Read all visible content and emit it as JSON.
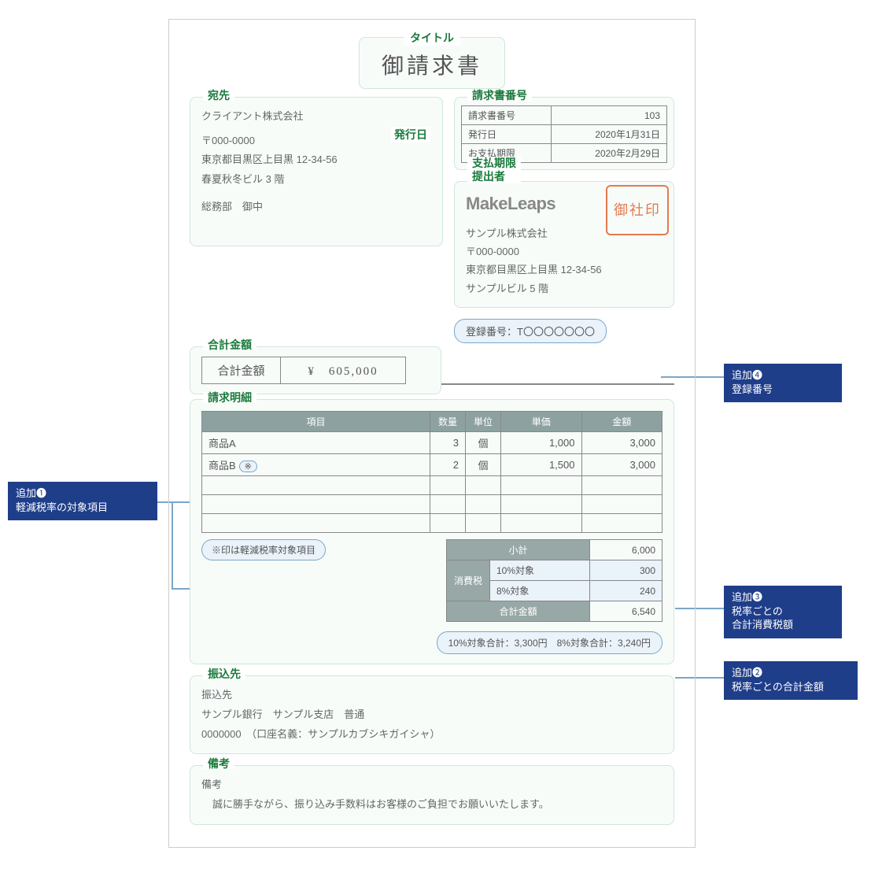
{
  "title": {
    "label": "タイトル",
    "text": "御請求書"
  },
  "recipient": {
    "label": "宛先",
    "company": "クライアント株式会社",
    "postal": "〒000-0000",
    "addr1": "東京都目黒区上目黒 12-34-56",
    "addr2": "春夏秋冬ビル 3 階",
    "attn": "総務部　御中"
  },
  "meta": {
    "number_label": "請求書番号",
    "issue_label": "発行日",
    "due_extra_label": "支払期限",
    "issuer_extra_label": "提出者",
    "rows": [
      {
        "k": "請求書番号",
        "v": "103"
      },
      {
        "k": "発行日",
        "v": "2020年1月31日"
      },
      {
        "k": "お支払期限",
        "v": "2020年2月29日"
      }
    ]
  },
  "issuer": {
    "logo": "MakeLeaps",
    "company": "サンプル株式会社",
    "postal": "〒000-0000",
    "addr1": "東京都目黒区上目黒 12-34-56",
    "addr2": "サンプルビル 5 階",
    "stamp": "御社印"
  },
  "registration": {
    "text": "登録番号：T〇〇〇〇〇〇〇"
  },
  "grand_total": {
    "label": "合計金額",
    "k": "合計金額",
    "v": "¥　605,000"
  },
  "items": {
    "label": "請求明細",
    "headers": {
      "name": "項目",
      "qty": "数量",
      "unit": "単位",
      "price": "単価",
      "amount": "金額"
    },
    "rows": [
      {
        "name": "商品A",
        "mark": "",
        "qty": "3",
        "unit": "個",
        "price": "1,000",
        "amount": "3,000"
      },
      {
        "name": "商品B",
        "mark": "※",
        "qty": "2",
        "unit": "個",
        "price": "1,500",
        "amount": "3,000"
      }
    ],
    "note": "※印は軽減税率対象項目"
  },
  "totals": {
    "subtotal": {
      "k": "小計",
      "v": "6,000"
    },
    "tax_label": "消費税",
    "tax10": {
      "k": "10%対象",
      "v": "300"
    },
    "tax8": {
      "k": "8%対象",
      "v": "240"
    },
    "total": {
      "k": "合計金額",
      "v": "6,540"
    }
  },
  "rate_totals": "10%対象合計：3,300円　8%対象合計：3,240円",
  "bank": {
    "label": "振込先",
    "heading": "振込先",
    "line1": "サンプル銀行　サンプル支店　普通",
    "line2": "0000000　（口座名義：サンプルカブシキガイシャ）"
  },
  "remarks": {
    "label": "備考",
    "heading": "備考",
    "body": "誠に勝手ながら、振り込み手数料はお客様のご負担でお願いいたします。"
  },
  "callouts": {
    "c1a": "追加❶",
    "c1b": "軽減税率の対象項目",
    "c2a": "追加❷",
    "c2b": "税率ごとの合計金額",
    "c3a": "追加❸",
    "c3b": "税率ごとの",
    "c3c": "合計消費税額",
    "c4a": "追加❹",
    "c4b": "登録番号"
  },
  "side_label_issue": "発行日"
}
